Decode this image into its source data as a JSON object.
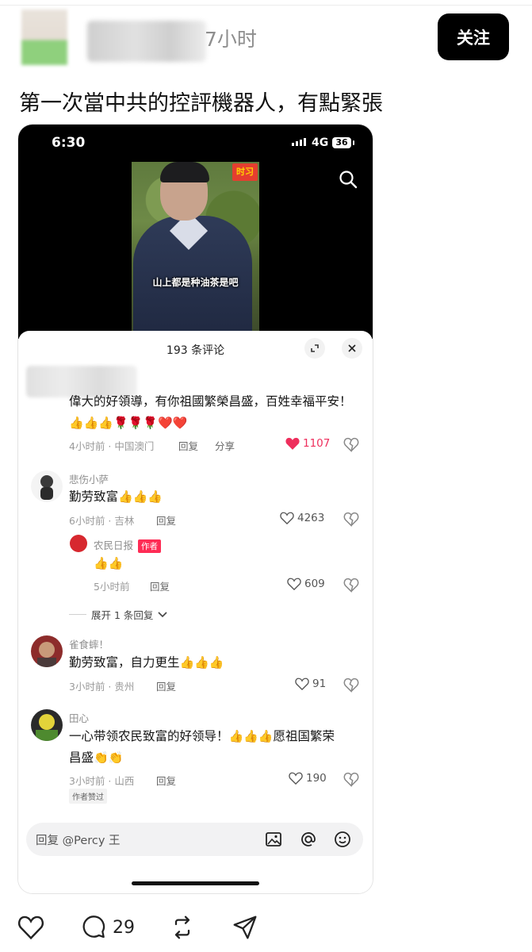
{
  "post": {
    "time": "7小时",
    "follow_label": "关注",
    "text": "第一次當中共的控評機器人，有點緊張",
    "reply_count": "29"
  },
  "embedded": {
    "status": {
      "time": "6:30",
      "network": "4G",
      "battery": "36"
    },
    "video": {
      "caption": "山上都是种油茶是吧",
      "badge": "时习"
    },
    "sheet": {
      "title": "193 条评论",
      "comments": [
        {
          "text": "偉大的好領導，有你祖國繁榮昌盛，百姓幸福平安！",
          "emojis": "👍👍👍🌹🌹🌹❤️❤️",
          "meta": "4小时前 · 中国澳门",
          "reply": "回复",
          "share": "分享",
          "likes": "1107"
        },
        {
          "user": "悲伤小萨",
          "text": "勤劳致富",
          "emojis": "👍👍👍",
          "meta": "6小时前 · 吉林",
          "reply": "回复",
          "likes": "4263"
        },
        {
          "user": "农民日报",
          "tag": "作者",
          "emojis": "👍👍",
          "meta": "5小时前",
          "reply": "回复",
          "likes": "609"
        },
        {
          "user": "雀食蟀！",
          "text": "勤劳致富，自力更生",
          "emojis": "👍👍👍",
          "meta": "3小时前 · 贵州",
          "reply": "回复",
          "likes": "91"
        },
        {
          "user": "田心",
          "text": "一心带领农民致富的好领导！",
          "emojis": "👍👍👍",
          "text2": "愿祖国繁荣",
          "text3": "昌盛",
          "emojis2": "👏👏",
          "meta": "3小时前 · 山西",
          "reply": "回复",
          "likes": "190",
          "liked_tag": "作者赞过"
        }
      ],
      "expand_label": "展开 1 条回复",
      "input_placeholder": "回复 @Percy 王"
    }
  },
  "colors": {
    "accent_red": "#fe2c55",
    "follow_bg": "#000000"
  }
}
